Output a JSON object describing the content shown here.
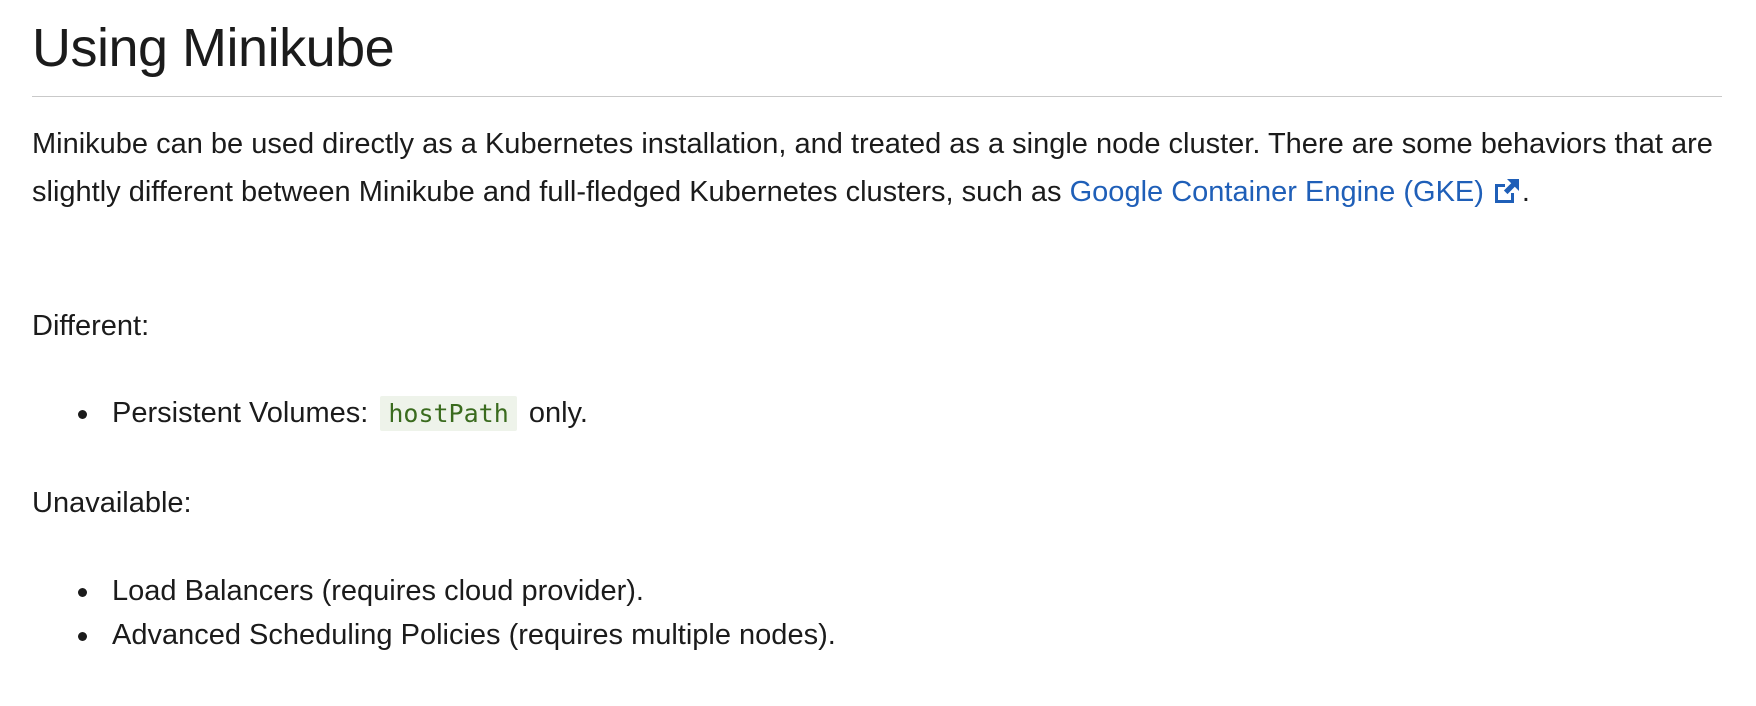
{
  "page": {
    "title": "Using Minikube",
    "intro": {
      "text_before_link": "Minikube can be used directly as a Kubernetes installation, and treated as a single node cluster. There are some behaviors that are slightly different between Minikube and full-fledged Kubernetes clusters, such as ",
      "link_text": "Google Container Engine (GKE)",
      "link_icon": "external-link-icon",
      "text_after_link": "."
    },
    "different": {
      "label": "Different:",
      "items": [
        {
          "before": "Persistent Volumes: ",
          "code": "hostPath",
          "after": " only."
        }
      ]
    },
    "unavailable": {
      "label": "Unavailable:",
      "items": [
        {
          "text": "Load Balancers (requires cloud provider)."
        },
        {
          "text": "Advanced Scheduling Policies (requires multiple nodes)."
        }
      ]
    }
  },
  "colors": {
    "text": "#1b1b1b",
    "link": "#1f5fb8",
    "code_text": "#3a6b1e",
    "code_background": "#eef3ea",
    "rule": "#c9c9c9"
  }
}
